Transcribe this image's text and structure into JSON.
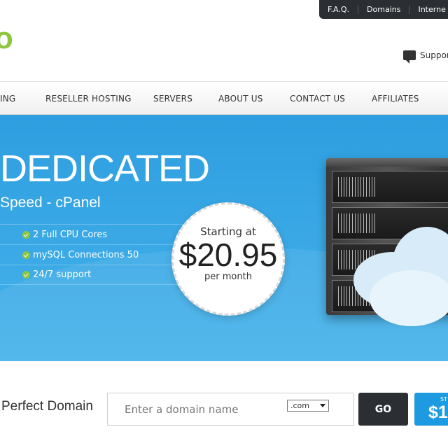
{
  "topbar": {
    "links": [
      "F.A.Q.",
      "Domains",
      "Interne"
    ]
  },
  "header": {
    "logo_text": "o",
    "support_label": "Support"
  },
  "nav": {
    "items": [
      "ING",
      "RESELLER HOSTING",
      "SERVERS",
      "ABOUT US",
      "CONTACT US",
      "AFFILIATES"
    ]
  },
  "hero": {
    "title": "DEDICATED",
    "subtitle": "Speed - cPanel",
    "features": [
      "2 Full CPU Cores",
      "mySQL Connections 50",
      "24/7 support"
    ],
    "badge": {
      "starting": "Starting at",
      "price": "$20.95",
      "period": "per month"
    }
  },
  "domain": {
    "label": "Perfect Domain",
    "placeholder": "Enter a domain name",
    "tld_selected": ".com",
    "go_label": "GO",
    "promo_small": "ST",
    "promo_price": "$1"
  },
  "colors": {
    "accent_green": "#8cc63f",
    "hero_blue": "#2e9ee0",
    "dark": "#2b2f33"
  }
}
